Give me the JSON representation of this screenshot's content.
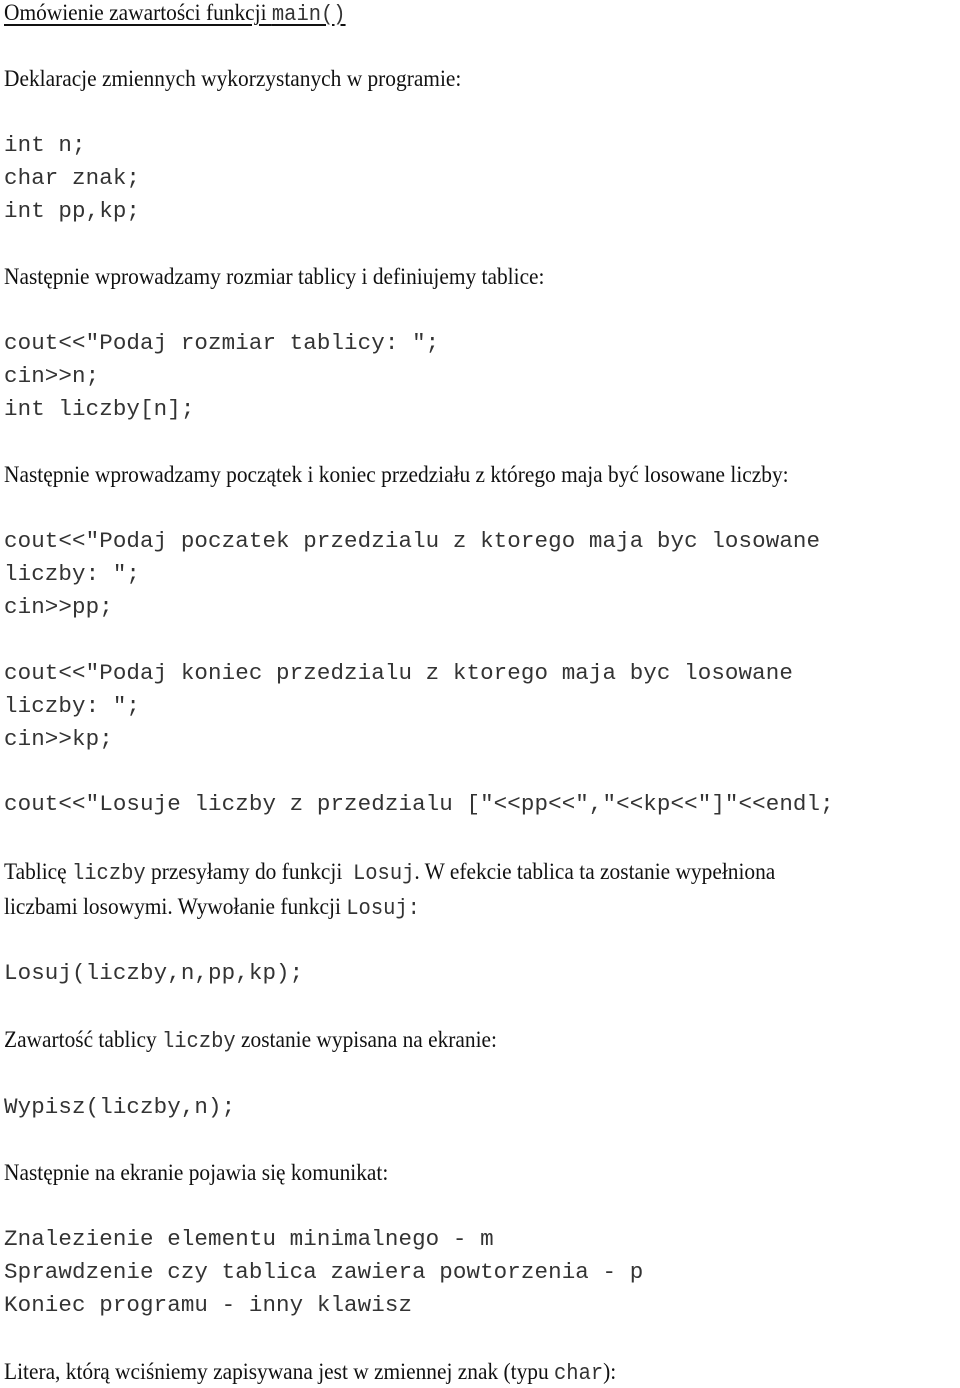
{
  "heading": {
    "text": "Omówienie zawartości funkcji ",
    "code": "main()"
  },
  "p_decl": "Deklaracje zmiennych wykorzystanych w programie:",
  "code_decl": [
    "int n;",
    "char znak;",
    "int pp,kp;"
  ],
  "p_size": "Następnie wprowadzamy rozmiar tablicy i definiujemy tablice:",
  "code_size": [
    "cout<<\"Podaj rozmiar tablicy: \";",
    "cin>>n;",
    "int liczby[n];"
  ],
  "p_range": "Następnie wprowadzamy początek i koniec przedziału z którego maja być losowane liczby:",
  "code_start": [
    "cout<<\"Podaj poczatek przedzialu z ktorego maja byc losowane",
    "liczby: \";",
    "cin>>pp;"
  ],
  "code_end": [
    "cout<<\"Podaj koniec przedzialu z ktorego maja byc losowane",
    "liczby: \";",
    "cin>>kp;"
  ],
  "code_losuje": "cout<<\"Losuje liczby z przedzialu [\"<<pp<<\",\"<<kp<<\"]\"<<endl;",
  "p_tab": {
    "a": "Tablicę ",
    "b": "liczby",
    "c": " przesyłamy do funkcji  ",
    "d": "Losuj",
    "e": ". W efekcie tablica ta zostanie wypełniona",
    "f": "liczbami losowymi. Wywołanie funkcji ",
    "g": "Losuj",
    "h": ":"
  },
  "code_call": "Losuj(liczby,n,pp,kp);",
  "p_print": {
    "a": "Zawartość tablicy ",
    "b": "liczby",
    "c": " zostanie wypisana na ekranie:"
  },
  "code_print": "Wypisz(liczby,n);",
  "p_msg": "Następnie na ekranie pojawia się komunikat:",
  "code_menu": [
    "Znalezienie elementu minimalnego - m",
    "Sprawdzenie czy tablica zawiera powtorzenia - p",
    "Koniec programu - inny klawisz"
  ],
  "p_last": {
    "a": "Litera, którą wciśniemy zapisywana jest w zmiennej znak (typu ",
    "b": "char",
    "c": "):"
  }
}
